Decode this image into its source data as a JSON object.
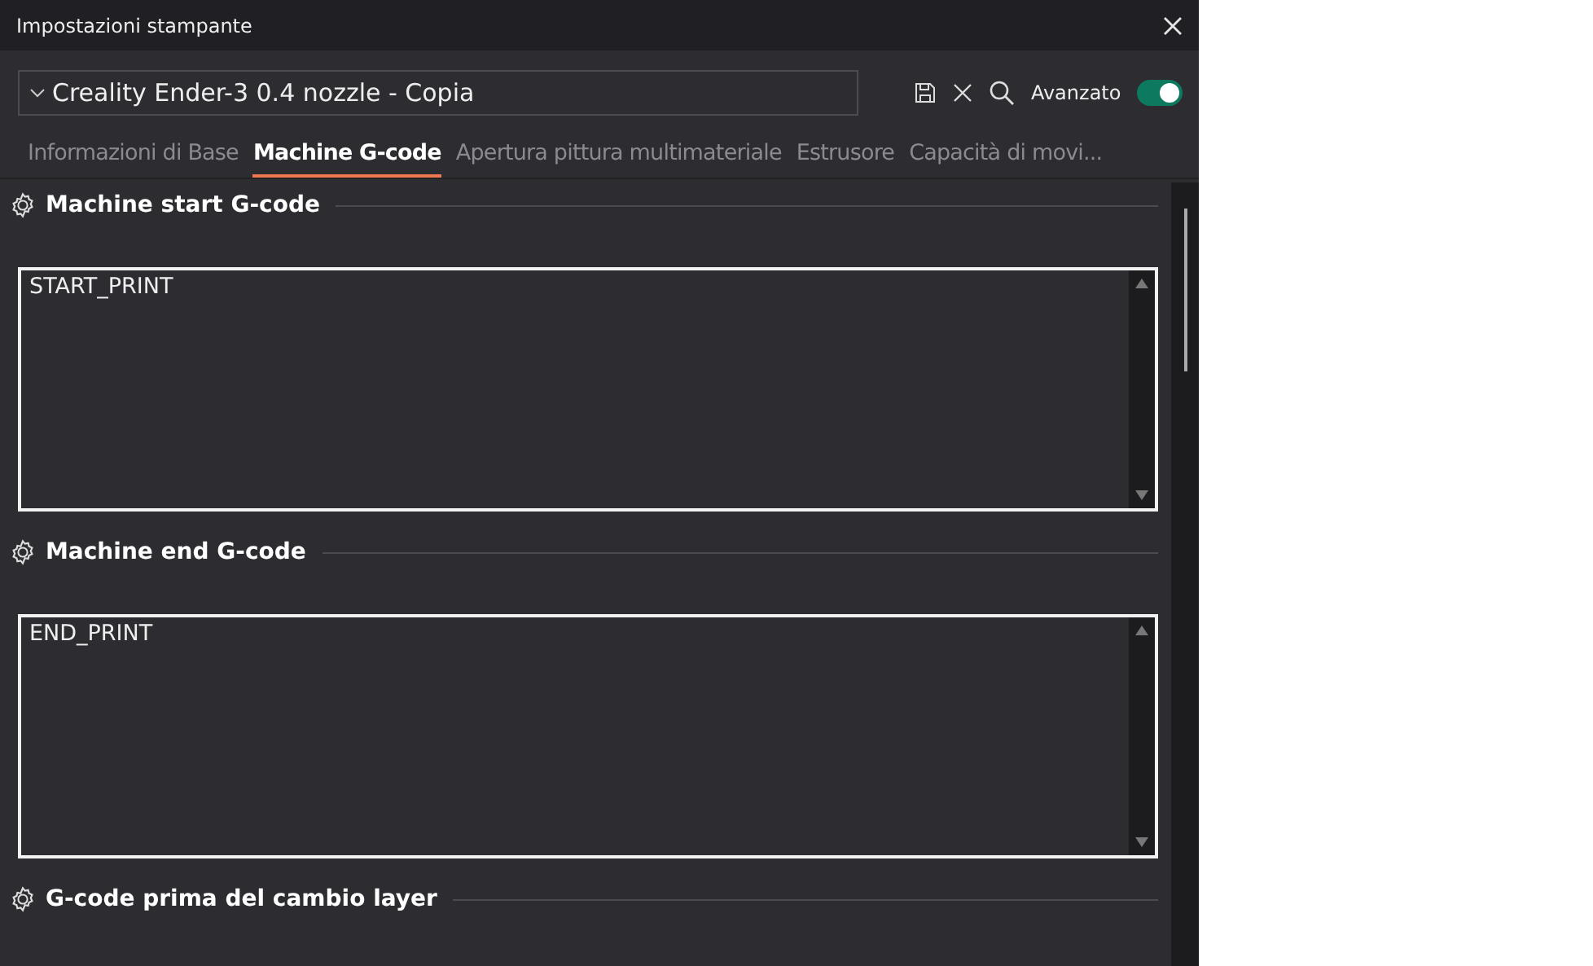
{
  "window": {
    "title": "Impostazioni stampante"
  },
  "preset": {
    "value": "Creality Ender-3 0.4 nozzle - Copia"
  },
  "advanced": {
    "label": "Avanzato",
    "on": true
  },
  "tabs": [
    {
      "label": "Informazioni di Base",
      "selected": false
    },
    {
      "label": "Machine G-code",
      "selected": true
    },
    {
      "label": "Apertura pittura multimateriale",
      "selected": false
    },
    {
      "label": "Estrusore",
      "selected": false
    },
    {
      "label": "Capacità di movi...",
      "selected": false
    }
  ],
  "sections": [
    {
      "title": "Machine start G-code",
      "code": "START_PRINT"
    },
    {
      "title": "Machine end G-code",
      "code": "END_PRINT"
    },
    {
      "title": "G-code prima del cambio layer"
    }
  ]
}
